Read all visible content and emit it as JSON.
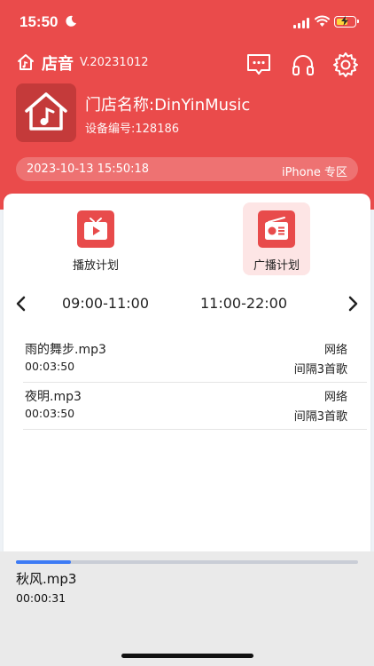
{
  "status_bar": {
    "time": "15:50"
  },
  "app": {
    "name": "店音",
    "version": "V.20231012"
  },
  "store": {
    "name": "门店名称:DinYinMusic",
    "device_no": "设备编号:128186"
  },
  "date_bar": {
    "datetime": "2023-10-13 15:50:18",
    "zone": "iPhone 专区"
  },
  "modes": [
    {
      "label": "播放计划",
      "icon": "play-plan-icon"
    },
    {
      "label": "广播计划",
      "icon": "radio-icon",
      "selected": true
    }
  ],
  "time_slots": [
    "09:00-11:00",
    "11:00-22:00"
  ],
  "tracks": [
    {
      "name": "雨的舞步.mp3",
      "duration": "00:03:50",
      "source": "网络",
      "interval": "间隔3首歌"
    },
    {
      "name": "夜明.mp3",
      "duration": "00:03:50",
      "source": "网络",
      "interval": "间隔3首歌"
    }
  ],
  "player": {
    "track": "秋风.mp3",
    "elapsed": "00:00:31",
    "progress": 0.16
  },
  "colors": {
    "brand_red": "#ea4b4b",
    "progress_blue": "#3d7bf5"
  }
}
